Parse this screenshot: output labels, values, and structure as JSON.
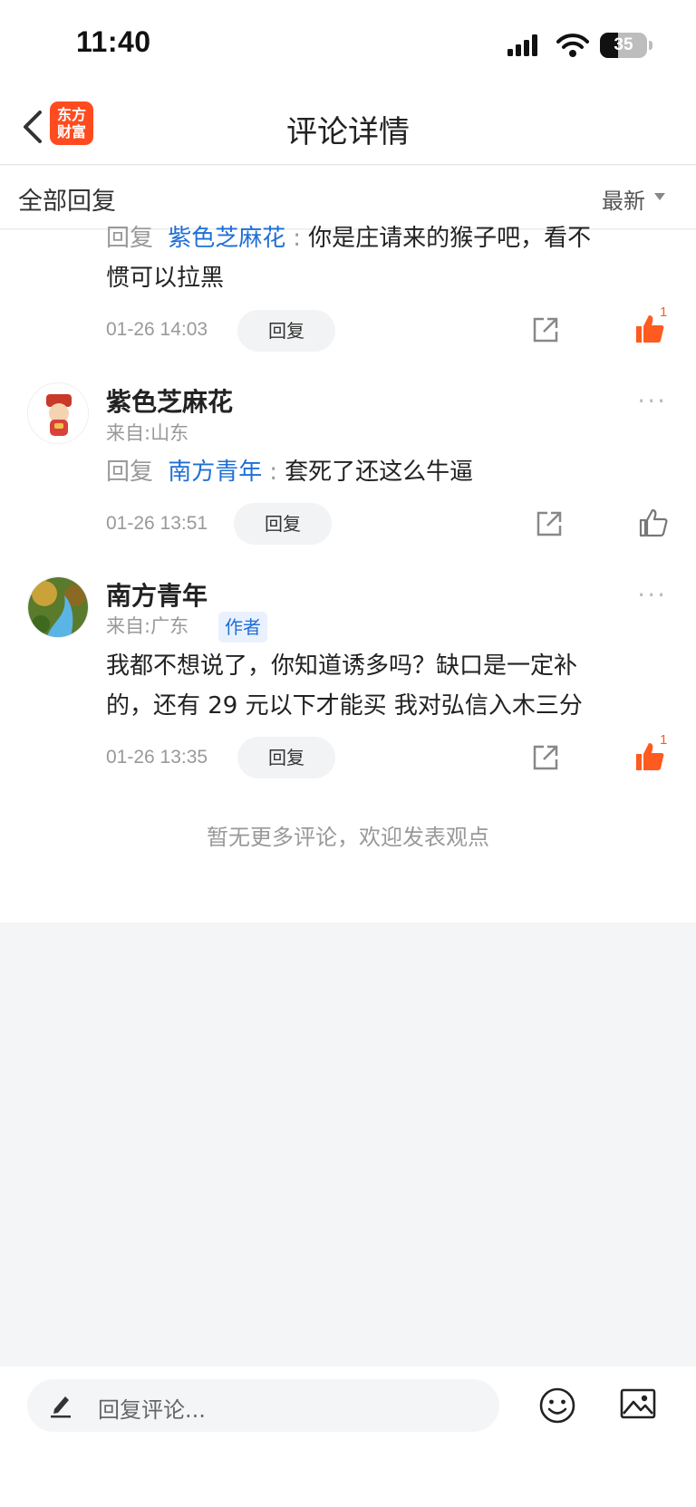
{
  "status_bar": {
    "time": "11:40",
    "battery": "35"
  },
  "nav": {
    "title": "评论详情",
    "logo_line1": "东方",
    "logo_line2": "财富"
  },
  "filter": {
    "all_replies": "全部回复",
    "sort": "最新"
  },
  "comments": [
    {
      "reply_prefix": "回复",
      "reply_to": "紫色芝麻花",
      "colon": ":",
      "text_line1": "你是庄请来的猴子吧，看不",
      "text_line2": "惯可以拉黑",
      "time": "01-26 14:03",
      "reply_label": "回复",
      "liked": true,
      "like_count": "1"
    },
    {
      "username": "紫色芝麻花",
      "origin": "来自:山东",
      "reply_prefix": "回复",
      "reply_to": "南方青年",
      "colon": ":",
      "text": "套死了还这么牛逼",
      "time": "01-26 13:51",
      "reply_label": "回复",
      "liked": false,
      "more": "···"
    },
    {
      "username": "南方青年",
      "badge": "作者",
      "origin": "来自:广东",
      "text_line1": "我都不想说了，你知道诱多吗？缺口是一定补",
      "text_line2": "的，还有 29 元以下才能买  我对弘信入木三分",
      "time": "01-26 13:35",
      "reply_label": "回复",
      "liked": true,
      "like_count": "1",
      "more": "···"
    }
  ],
  "end_message": "暂无更多评论，欢迎发表观点",
  "bottom": {
    "input_placeholder": "回复评论..."
  },
  "colors": {
    "accent": "#ff5a1f",
    "link": "#1f6fd6",
    "logo": "#ff4b1f"
  },
  "icons": [
    "back-arrow-icon",
    "signal-icon",
    "wifi-icon",
    "battery-icon",
    "share-icon",
    "thumbs-up-icon",
    "pencil-icon",
    "emoji-icon",
    "image-icon"
  ]
}
